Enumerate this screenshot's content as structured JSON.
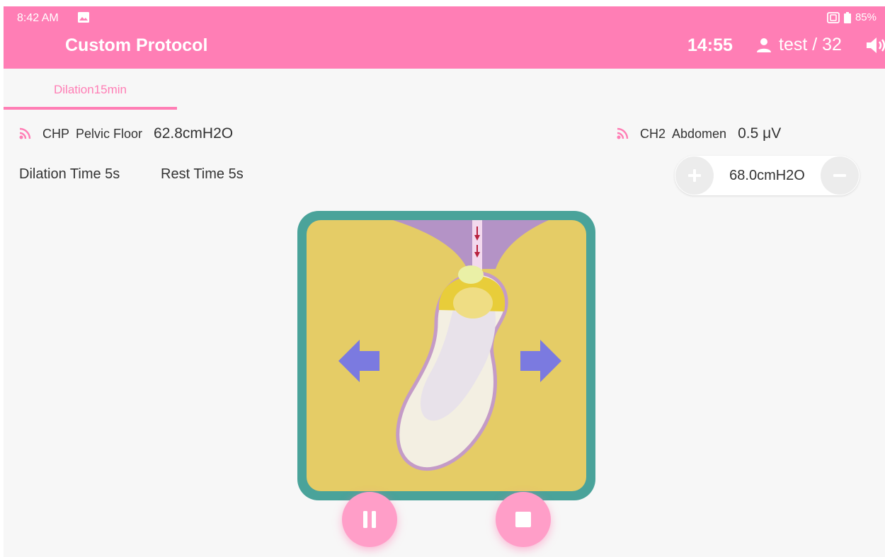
{
  "status_bar": {
    "time": "8:42 AM",
    "battery": "85%",
    "icons": [
      "image-icon",
      "nfc-icon",
      "battery-icon"
    ]
  },
  "app_bar": {
    "title": "Custom Protocol",
    "timer": "14:55",
    "user": "test / 32",
    "icons": [
      "user-icon",
      "speaker-icon"
    ]
  },
  "tabs": [
    {
      "label": "Dilation15min",
      "selected": true
    }
  ],
  "channels": [
    {
      "code": "CHP",
      "name": "Pelvic Floor",
      "value": "62.8cmH2O",
      "icon": "signal-icon"
    },
    {
      "code": "CH2",
      "name": "Abdomen",
      "value": "0.5 μV",
      "icon": "signal-icon"
    }
  ],
  "timing": {
    "dilation": "Dilation Time 5s",
    "rest": "Rest Time 5s"
  },
  "pressure_stepper": {
    "value": "68.0cmH2O",
    "icons": [
      "plus-icon",
      "minus-icon"
    ]
  },
  "illustration": {
    "icon": "dilation-balloon-illustration",
    "arrows": [
      "arrow-left-icon",
      "arrow-right-icon"
    ]
  },
  "controls": {
    "icons": [
      "pause-icon",
      "stop-icon"
    ]
  },
  "colors": {
    "accent": "#ff7eb5",
    "button": "#ff9ec8",
    "frame_teal": "#4aa39a",
    "fill_yellow": "#e5cc66",
    "tissue_purple": "#b493c6",
    "arrow_purple": "#7b7ae0"
  }
}
